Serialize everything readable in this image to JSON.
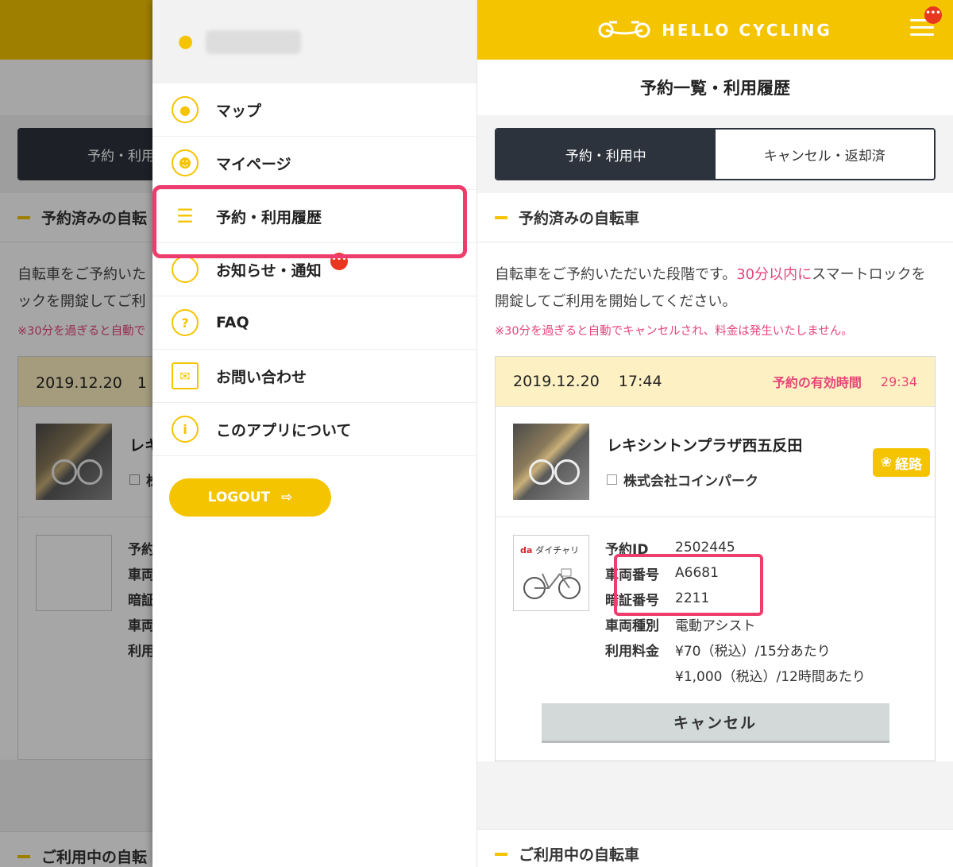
{
  "app": {
    "logo_text": "HELLO CYCLING",
    "menu_badge": "•••"
  },
  "page": {
    "title": "予約一覧・利用履歴"
  },
  "tabs": [
    {
      "label": "予約・利用中",
      "active": true
    },
    {
      "label": "キャンセル・返却済",
      "active": false
    }
  ],
  "reserved_section": {
    "title": "予約済みの自転車",
    "desc_1": "自転車をご予約いただいた段階です。",
    "desc_highlight": "30分以内に",
    "desc_2": "スマートロックを開錠してご利用を開始してください。",
    "note": "※30分を過ぎると自動でキャンセルされ、料金は発生いたしません。"
  },
  "reservation": {
    "date": "2019.12.20",
    "time": "17:44",
    "valid_label": "予約の有効時間",
    "remaining": "29:34",
    "station_name": "レキシントンプラザ西五反田",
    "company": "株式会社コインパーク",
    "route_label": "経路",
    "brand": "da",
    "brand_sub": "ダイチャリ",
    "specs": [
      {
        "label": "予約ID",
        "value": "2502445"
      },
      {
        "label": "車両番号",
        "value": "A6681"
      },
      {
        "label": "暗証番号",
        "value": "2211"
      },
      {
        "label": "車両種別",
        "value": "電動アシスト"
      },
      {
        "label": "利用料金",
        "value": "¥70（税込）/15分あたり"
      },
      {
        "label": "",
        "value": "¥1,000（税込）/12時間あたり"
      }
    ],
    "cancel_label": "キャンセル"
  },
  "in_use_section": {
    "title": "ご利用中の自転車"
  },
  "left_behind": {
    "tab_partial": "予約・利用",
    "section_partial": "予約済みの自転",
    "desc_partial_1": "自転車をご予約いた",
    "desc_partial_2": "ックを開錠してご利",
    "note_partial": "※30分を過ぎると自動で",
    "date_partial": "2019.12.20　1",
    "station_partial": "レキ",
    "company_partial": "株",
    "specs_partial": [
      "予約",
      "車両",
      "暗証",
      "車両",
      "利用"
    ],
    "in_use_partial": "ご利用中の自転"
  },
  "drawer": {
    "menu": [
      {
        "label": "マップ",
        "icon": "map-pin-icon"
      },
      {
        "label": "マイページ",
        "icon": "user-circle-icon"
      },
      {
        "label": "予約・利用履歴",
        "icon": "list-icon"
      },
      {
        "label": "お知らせ・通知",
        "icon": "speech-bubble-icon",
        "badge": "•••"
      },
      {
        "label": "FAQ",
        "icon": "question-icon"
      },
      {
        "label": "お問い合わせ",
        "icon": "envelope-icon"
      },
      {
        "label": "このアプリについて",
        "icon": "info-icon"
      }
    ],
    "logout_label": "LOGOUT"
  },
  "colors": {
    "brand_yellow": "#f5c400",
    "accent_pink": "#e6457a",
    "highlight_pink": "#ee3d6d",
    "tab_dark": "#2d333d"
  }
}
